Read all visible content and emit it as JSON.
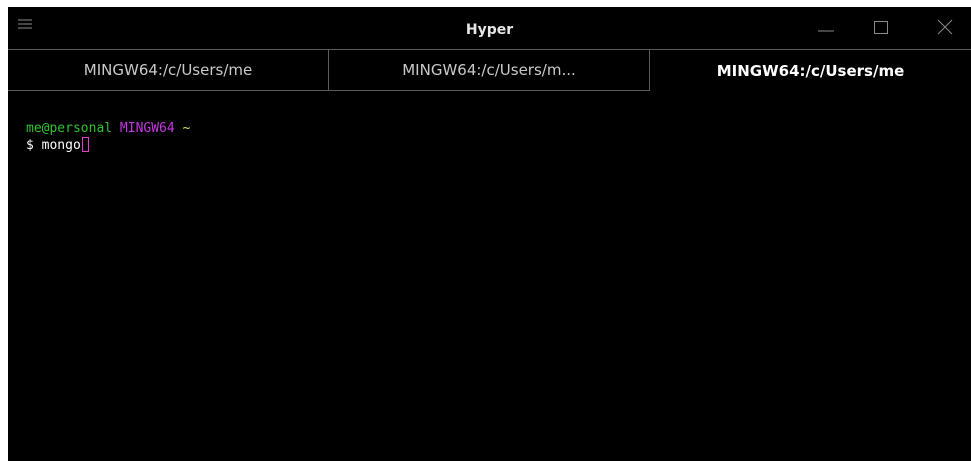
{
  "window": {
    "title": "Hyper"
  },
  "tabs": [
    {
      "label": "MINGW64:/c/Users/me"
    },
    {
      "label": "MINGW64:/c/Users/m..."
    },
    {
      "label": "MINGW64:/c/Users/me"
    }
  ],
  "terminal": {
    "prompt": {
      "user_host": "me@personal",
      "system": "MINGW64",
      "path": "~"
    },
    "dollar": "$",
    "command": "mongo"
  },
  "colors": {
    "user_host": "#2ec42e",
    "system": "#c837e6",
    "path": "#e8d44d",
    "cursor": "#e93ad0"
  }
}
